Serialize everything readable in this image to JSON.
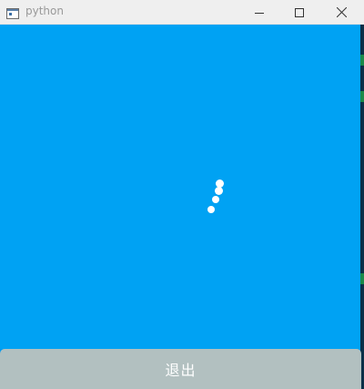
{
  "window": {
    "title": "python",
    "icon": "python-app-icon",
    "controls": [
      "minimize-icon",
      "maximize-icon",
      "close-icon"
    ]
  },
  "main": {
    "background_color": "#00a2f3",
    "spinner": {
      "icon": "loading-spinner-icon",
      "color": "#ffffff"
    }
  },
  "footer": {
    "quit_label": "退出",
    "button_color": "#b2c0c0"
  }
}
